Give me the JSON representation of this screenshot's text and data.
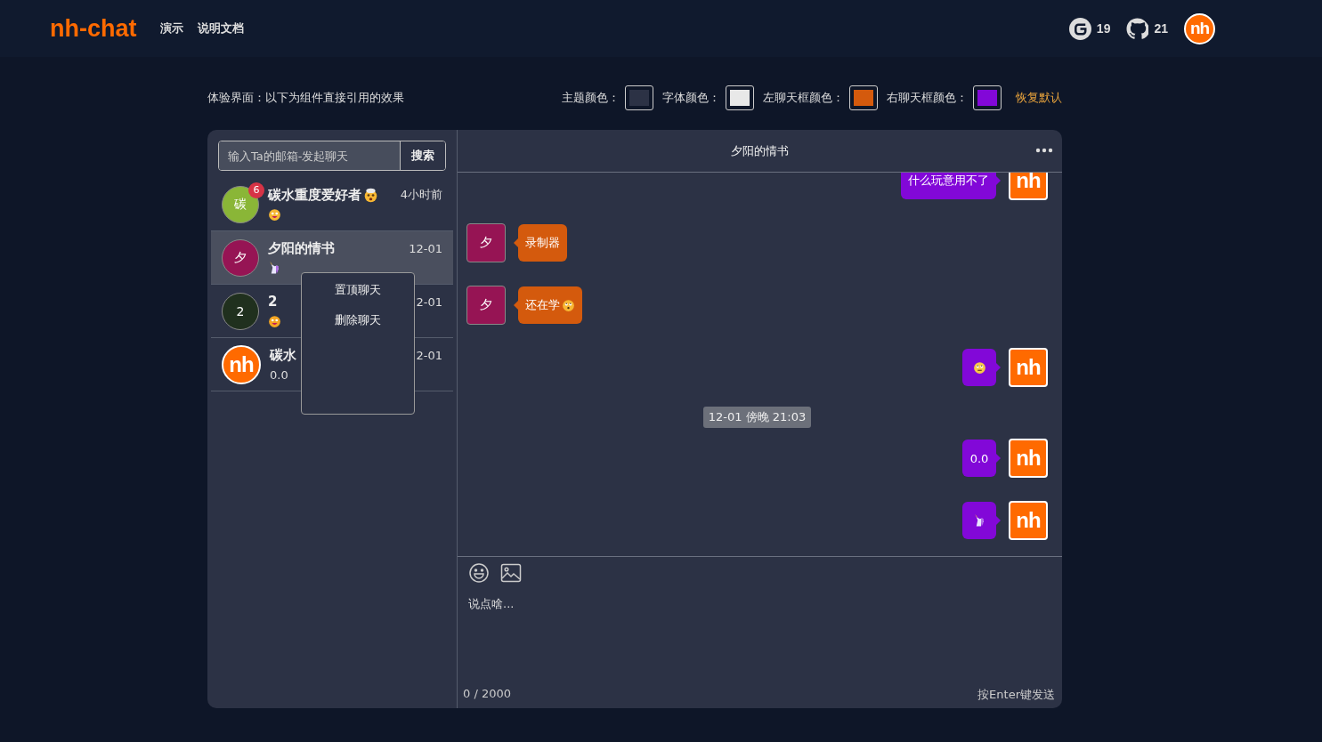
{
  "header": {
    "logo": "nh-chat",
    "nav": [
      {
        "label": "演示"
      },
      {
        "label": "说明文档"
      }
    ],
    "stats": [
      {
        "kind": "gitee",
        "count": "19"
      },
      {
        "kind": "github",
        "count": "21"
      }
    ],
    "avatar": {
      "kind": "logo",
      "text": "nh"
    }
  },
  "toolbar": {
    "intro": "体验界面：以下为组件直接引用的效果",
    "colors": [
      {
        "label": "主题颜色：",
        "color": "#2c3245"
      },
      {
        "label": "字体颜色：",
        "color": "#e8e8e8"
      },
      {
        "label": "左聊天框颜色：",
        "color": "#d45a0d"
      },
      {
        "label": "右聊天框颜色：",
        "color": "#8208d8"
      }
    ],
    "reset": "恢复默认"
  },
  "sidebar": {
    "search": {
      "placeholder": "输入Ta的邮箱-发起聊天",
      "button": "搜索"
    },
    "contacts": [
      {
        "name": "碳水重度爱好者",
        "name_emoji": {
          "kind": "exploding-head"
        },
        "time": "4小时前",
        "preview": {
          "emoji": {
            "kind": "zany-face"
          }
        },
        "avatar": {
          "kind": "letter",
          "text": "碳",
          "color": "#8ab637"
        },
        "badge": "6",
        "selected": false
      },
      {
        "name": "夕阳的情书",
        "time": "12-01",
        "preview": {
          "emoji": {
            "kind": "unicorn"
          }
        },
        "avatar": {
          "kind": "letter",
          "text": "夕",
          "color": "#961454"
        },
        "selected": true
      },
      {
        "name": "2",
        "time": "2-01",
        "preview": {
          "emoji": {
            "kind": "grimace-face"
          }
        },
        "avatar": {
          "kind": "letter",
          "text": "2",
          "color": "#20301e"
        },
        "selected": false
      },
      {
        "name": "碳水",
        "time": "2-01",
        "preview": {
          "text": "0.0"
        },
        "avatar": {
          "kind": "logo",
          "text": "nh"
        },
        "selected": false
      }
    ],
    "context_menu": [
      {
        "label": "置顶聊天"
      },
      {
        "label": "删除聊天"
      }
    ]
  },
  "chat": {
    "title": "夕阳的情书",
    "messages": [
      {
        "kind": "right",
        "text": "什么玩意用不了",
        "avatar": {
          "kind": "logo",
          "text": "nh"
        }
      },
      {
        "kind": "left",
        "text": "录制器",
        "avatar": {
          "kind": "letter",
          "text": "夕",
          "color": "#961454"
        }
      },
      {
        "kind": "left",
        "text": "还在学",
        "emoji": {
          "kind": "flushed-face"
        },
        "avatar": {
          "kind": "letter",
          "text": "夕",
          "color": "#961454"
        }
      },
      {
        "kind": "right",
        "emoji": {
          "kind": "rolling-eyes"
        },
        "avatar": {
          "kind": "logo",
          "text": "nh"
        }
      },
      {
        "kind": "time",
        "text": "12-01 傍晚 21:03"
      },
      {
        "kind": "right",
        "text": "0.0",
        "avatar": {
          "kind": "logo",
          "text": "nh"
        }
      },
      {
        "kind": "right",
        "emoji": {
          "kind": "unicorn"
        },
        "avatar": {
          "kind": "logo",
          "text": "nh"
        }
      }
    ],
    "composer": {
      "placeholder": "说点啥...",
      "counter": "0 / 2000",
      "hint": "按Enter键发送"
    }
  }
}
